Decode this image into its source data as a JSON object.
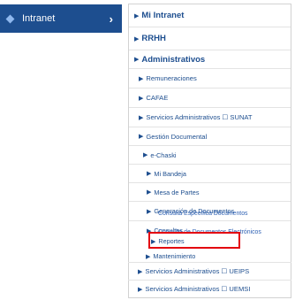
{
  "sidebar": {
    "label": "Intranet",
    "chevron": "›",
    "icon": "diamond-bullet-icon"
  },
  "menu": [
    {
      "label": "Mi Intranet",
      "level": 1
    },
    {
      "label": "RRHH",
      "level": 1
    },
    {
      "label": "Administrativos",
      "level": 1
    },
    {
      "label": "Remuneraciones",
      "level": 2
    },
    {
      "label": "CAFAE",
      "level": 2
    },
    {
      "label": "Servicios Administrativos ☐ SUNAT",
      "level": 2
    },
    {
      "label": "Gestión Documental",
      "level": 2
    },
    {
      "label": "e-Chaski",
      "level": 3
    },
    {
      "label": "Mi Bandeja",
      "level": 4
    },
    {
      "label": "Mesa de Partes",
      "level": 4
    },
    {
      "label": "Generación de Documentos",
      "level": 4
    },
    {
      "label": "Consultas",
      "level": 4
    },
    {
      "label": "Consulta Específica Documentos",
      "level": 6
    },
    {
      "label": "Consulta de Documentos Electrónicos",
      "level": 6
    },
    {
      "label": "Reportes",
      "level": 5,
      "highlighted": true
    },
    {
      "label": "Mantenimiento",
      "level": 4
    },
    {
      "label": "Servicios Administrativos ☐ UEIPS",
      "level": 2
    },
    {
      "label": "Servicios Administrativos ☐ UEMSI",
      "level": 2
    }
  ],
  "colors": {
    "sidebar_bg": "#1d4e8f",
    "link": "#1d4e8f",
    "sublink": "#2f62b4",
    "highlight": "#e3000f"
  }
}
